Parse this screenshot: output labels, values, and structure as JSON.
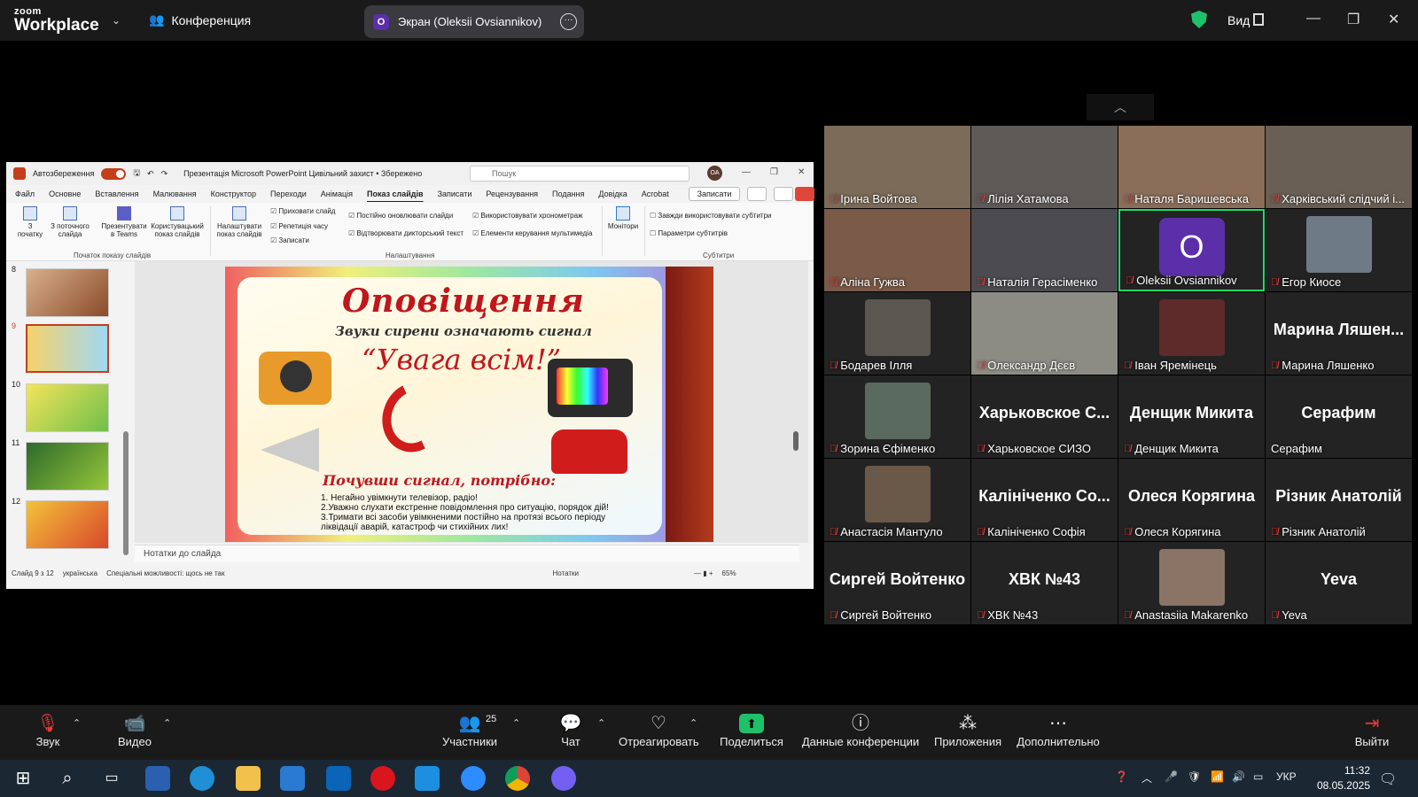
{
  "topbar": {
    "logo_top": "zoom",
    "logo_bottom": "Workplace",
    "conference_label": "Конференция",
    "share_avatar": "O",
    "share_label": "Экран (Oleksii Ovsiannikov)",
    "view_label": "Вид"
  },
  "ppt": {
    "autosave": "Автозбереження",
    "title": "Презентація Microsoft PowerPoint Цивільний захист • Збережено",
    "search_placeholder": "Пошук",
    "avatar": "OA",
    "tabs": [
      "Файл",
      "Основне",
      "Вставлення",
      "Малювання",
      "Конструктор",
      "Переходи",
      "Анімація",
      "Показ слайдів",
      "Записати",
      "Рецензування",
      "Подання",
      "Довідка",
      "Acrobat"
    ],
    "record_btn": "Записати",
    "ribbon": {
      "from_start": "З початку",
      "from_current": "З поточного слайда",
      "present_teams": "Презентувати в Teams",
      "custom_show": "Користувацький показ слайдів",
      "setup_show": "Налаштувати показ слайдів",
      "hide_slide": "Приховати слайд",
      "rehearse": "Репетиція часу",
      "record": "Записати",
      "keep_updated": "Постійно оновлювати слайди",
      "play_narrations": "Відтворювати дикторський текст",
      "use_timings": "Використовувати хронометраж",
      "media_controls": "Елементи керування мультимедіа",
      "monitors": "Монітори",
      "always_subtitles": "Завжди використовувати субтитри",
      "subtitle_settings": "Параметри субтитрів",
      "group_start": "Початок показу слайдів",
      "group_setup": "Налаштування",
      "group_subtitles": "Субтитри"
    },
    "slide_numbers": [
      "8",
      "9",
      "10",
      "11",
      "12"
    ],
    "slide": {
      "title": "Оповіщення",
      "subtitle": "Звуки сирени означають сигнал",
      "quote": "“Увага всім!”",
      "heard_signal": "Почувши сигнал, потрібно:",
      "list": [
        "1. Негайно увімкнути телевізор, радіо!",
        "2.Уважно слухати екстренне повідомлення про ситуацію, порядок дій!",
        "3.Тримати всі засоби увімкненими постійно на протязі всього періоду ліквідації аварій, катастроф чи стихійних лих!"
      ]
    },
    "notes_placeholder": "Нотатки до слайда",
    "status": {
      "slide_of": "Слайд 9 з 12",
      "language": "українська",
      "accessibility": "Спеціальні можливості: щось не так",
      "notes": "Нотатки",
      "zoom": "65%"
    }
  },
  "participants": [
    {
      "name": "Ірина Войтова",
      "video": true,
      "big": ""
    },
    {
      "name": "Лілія Хатамова",
      "video": true,
      "big": ""
    },
    {
      "name": "Наталя Баришевська",
      "video": true,
      "big": ""
    },
    {
      "name": "Харківський слідчий і...",
      "video": true,
      "big": ""
    },
    {
      "name": "Аліна Гужва",
      "video": true,
      "big": ""
    },
    {
      "name": "Наталія Герасіменко",
      "video": true,
      "big": ""
    },
    {
      "name": "Oleksii Ovsiannikov",
      "video": false,
      "big": "",
      "avatar": "O"
    },
    {
      "name": "Егор Киосе",
      "video": true,
      "big": ""
    },
    {
      "name": "Бодарев Ілля",
      "video": true,
      "big": ""
    },
    {
      "name": "Олександр Дєєв",
      "video": true,
      "big": ""
    },
    {
      "name": "Іван Яремінець",
      "video": true,
      "big": ""
    },
    {
      "name": "Марина Ляшенко",
      "video": false,
      "big": "Марина Ляшен..."
    },
    {
      "name": "Зорина Єфіменко",
      "video": true,
      "big": ""
    },
    {
      "name": "Харьковское СИЗО",
      "video": false,
      "big": "Харьковское С..."
    },
    {
      "name": "Денщик Микита",
      "video": false,
      "big": "Денщик Микита"
    },
    {
      "name": "Серафим",
      "video": false,
      "big": "Серафим"
    },
    {
      "name": "Анастасія Мантуло",
      "video": true,
      "big": ""
    },
    {
      "name": "Калініченко Софія",
      "video": false,
      "big": "Калініченко Со..."
    },
    {
      "name": "Олеся Корягина",
      "video": false,
      "big": "Олеся Корягина"
    },
    {
      "name": "Різник Анатолій",
      "video": false,
      "big": "Різник Анатолій"
    },
    {
      "name": "Сиргей Войтенко",
      "video": false,
      "big": "Сиргей Войтенко"
    },
    {
      "name": "ХВК №43",
      "video": false,
      "big": "ХВК №43"
    },
    {
      "name": "Anastasiia Makarenko",
      "video": true,
      "big": ""
    },
    {
      "name": "Yeva",
      "video": false,
      "big": "Yeva"
    }
  ],
  "toolbar": {
    "audio": "Звук",
    "video": "Видео",
    "participants": "Участники",
    "participants_count": "25",
    "chat": "Чат",
    "react": "Отреагировать",
    "share": "Поделиться",
    "meeting_info": "Данные конференции",
    "apps": "Приложения",
    "more": "Дополнительно",
    "leave": "Выйти"
  },
  "taskbar": {
    "lang": "УКР",
    "time": "11:32",
    "date": "08.05.2025"
  },
  "colors": {
    "accent_green": "#23d96b",
    "zoom_share": "#1ec16a",
    "ppt_red": "#c43e1c",
    "muted_red": "#e83a3a"
  }
}
